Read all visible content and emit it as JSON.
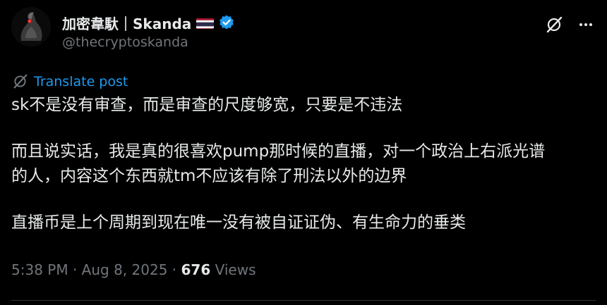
{
  "author": {
    "display_name": "加密韋馱｜Skanda",
    "handle": "@thecryptoskanda",
    "flag_icon": "thailand-flag-icon",
    "verified_icon": "verified-badge-icon",
    "verified_color": "#1d9bf0"
  },
  "actions": {
    "grok_icon": "grok-icon",
    "more_icon": "more-icon"
  },
  "translate": {
    "label": "Translate post",
    "icon": "translate-icon",
    "color": "#1d9bf0"
  },
  "post": {
    "paragraphs": [
      [
        "sk不是没有审查，而是审查的尺度够宽，只要是不违法"
      ],
      [
        "而且说实话，我是真的很喜欢pump那时候的直播，对一个政治上右派光谱",
        "的人，内容这个东西就tm不应该有除了刑法以外的边界"
      ],
      [
        "直播币是上个周期到现在唯一没有被自证证伪、有生命力的垂类"
      ]
    ]
  },
  "meta": {
    "time": "5:38 PM",
    "separator": "·",
    "date": "Aug 8, 2025",
    "views_count": "676",
    "views_label": "Views"
  },
  "colors": {
    "background": "#000000",
    "text": "#e7e9ea",
    "muted": "#71767b",
    "accent": "#1d9bf0"
  }
}
